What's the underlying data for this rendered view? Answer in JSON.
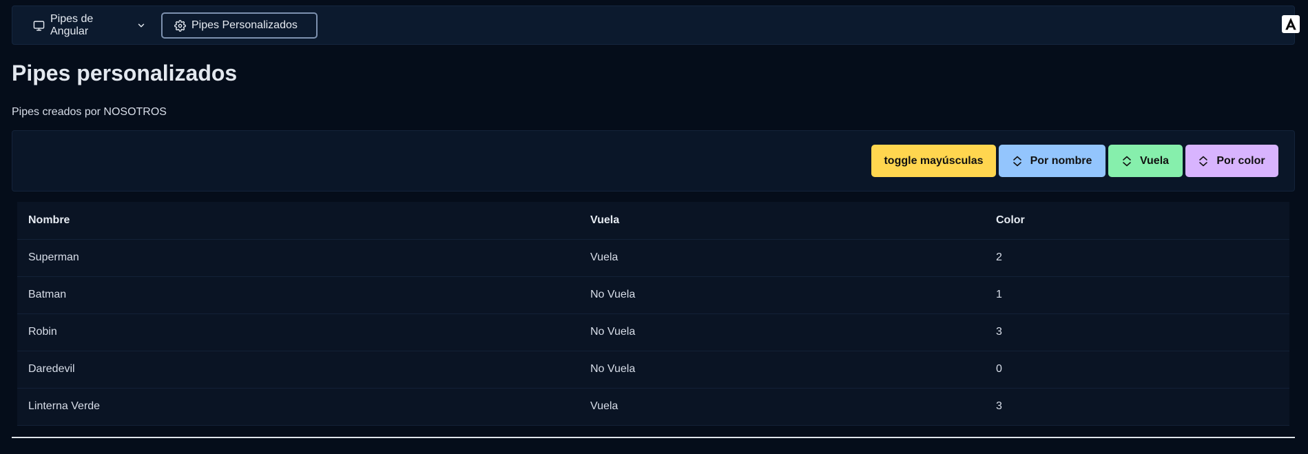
{
  "navbar": {
    "dropdown": {
      "label": "Pipes de Angular",
      "icon": "monitor-icon"
    },
    "active_link": {
      "label": "Pipes Personalizados",
      "icon": "gear-icon"
    },
    "brand_icon": "angular-logo-icon"
  },
  "page": {
    "title": "Pipes personalizados",
    "subtitle": "Pipes creados por NOSOTROS"
  },
  "toolbar": {
    "toggle_label": "toggle mayúsculas",
    "sort_name_label": "Por nombre",
    "sort_vuela_label": "Vuela",
    "sort_color_label": "Por color",
    "sort_icon": "sort-arrows-icon"
  },
  "table": {
    "headers": [
      "Nombre",
      "Vuela",
      "Color"
    ],
    "rows": [
      [
        "Superman",
        "Vuela",
        "2"
      ],
      [
        "Batman",
        "No Vuela",
        "1"
      ],
      [
        "Robin",
        "No Vuela",
        "3"
      ],
      [
        "Daredevil",
        "No Vuela",
        "0"
      ],
      [
        "Linterna Verde",
        "Vuela",
        "3"
      ]
    ]
  },
  "colors": {
    "background": "#050d1a",
    "toggle_button": "#ffd64f",
    "name_button": "#93c5fd",
    "vuela_button": "#86efac",
    "color_button": "#d8b4fe"
  }
}
